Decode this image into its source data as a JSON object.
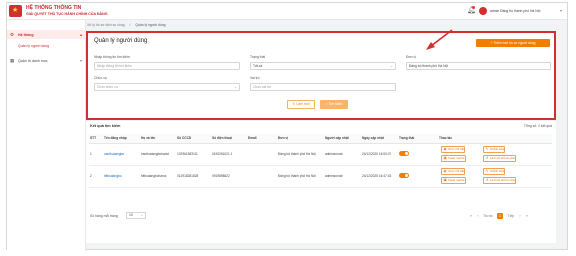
{
  "header": {
    "system_title": "HỆ THỐNG THÔNG TIN",
    "system_subtitle": "GIẢI QUYẾT THỦ TỤC HÀNH CHÍNH CỦA ĐẢNG",
    "user_name": "admin Đảng bộ thành phố Hà Nội"
  },
  "sidebar": {
    "group_label": "Hệ thống",
    "group_item": "Quản lý người dùng",
    "item2_label": "Quản trị danh mục"
  },
  "breadcrumb": [
    "Xử lý hồ sơ dịch vụ công",
    "Quản lý người dùng"
  ],
  "search": {
    "title": "Quản lý người dùng",
    "add_button": "+ Thêm mới hồ sơ người dùng",
    "fields": {
      "keyword_label": "Nhập thông tin tìm kiếm",
      "keyword_placeholder": "Nhập thông tin tìm kiếm",
      "status_label": "Trạng thái",
      "status_value": "Tất cả",
      "unit_label": "Đơn vị",
      "unit_value": "Đảng bộ thành phố Hà Nội",
      "position_label": "Chức vụ",
      "position_placeholder": "Chọn chức vụ",
      "role_label": "Vai trò",
      "role_placeholder": "Chọn vai trò"
    },
    "clear_button": "Làm mới",
    "search_button": "Tìm kiếm"
  },
  "results": {
    "title": "Kết quả tìm kiếm",
    "total": "Tổng số: 2 kết quả",
    "columns": [
      "STT",
      "Tên đăng nhập",
      "Họ và tên",
      "Số CCCD",
      "Số điện thoại",
      "Email",
      "Đơn vị",
      "Người cập nhật",
      "Ngày cập nhật",
      "Trạng thái",
      "Thao tác"
    ],
    "rows": [
      {
        "stt": "1",
        "username": "vanthudangbo",
        "fullname": "vanthudangbohanoi",
        "cccd": "102961583111",
        "phone": "0190261021 1",
        "email": "",
        "unit": "Đảng bộ thành phố Hà Nội",
        "updated_by": "adminsonoiv",
        "updated_at": "24/12/2025 16:53:07",
        "active": true
      },
      {
        "stt": "2",
        "username": "bithudangbo",
        "fullname": "bithudangbohanoi",
        "cccd": "012918281828",
        "phone": "0919898822",
        "email": "",
        "unit": "Đảng bộ thành phố Hà Nội",
        "updated_by": "adminsonoiv",
        "updated_at": "24/12/2025 16:47:43",
        "active": true
      }
    ],
    "actions": {
      "view": "Xem chi tiết",
      "edit": "Chỉnh sửa",
      "clear_cache": "Clear cache",
      "history": "Lịch sử chỉnh sửa"
    },
    "page_size_label": "Số hàng mỗi trang",
    "page_size_value": "10",
    "pagination": {
      "prev": "Trước",
      "current": "1",
      "next": "Tiếp"
    }
  },
  "colors": {
    "accent": "#f57c00",
    "brand_red": "#c62828",
    "highlight_border": "#d32f2f"
  }
}
